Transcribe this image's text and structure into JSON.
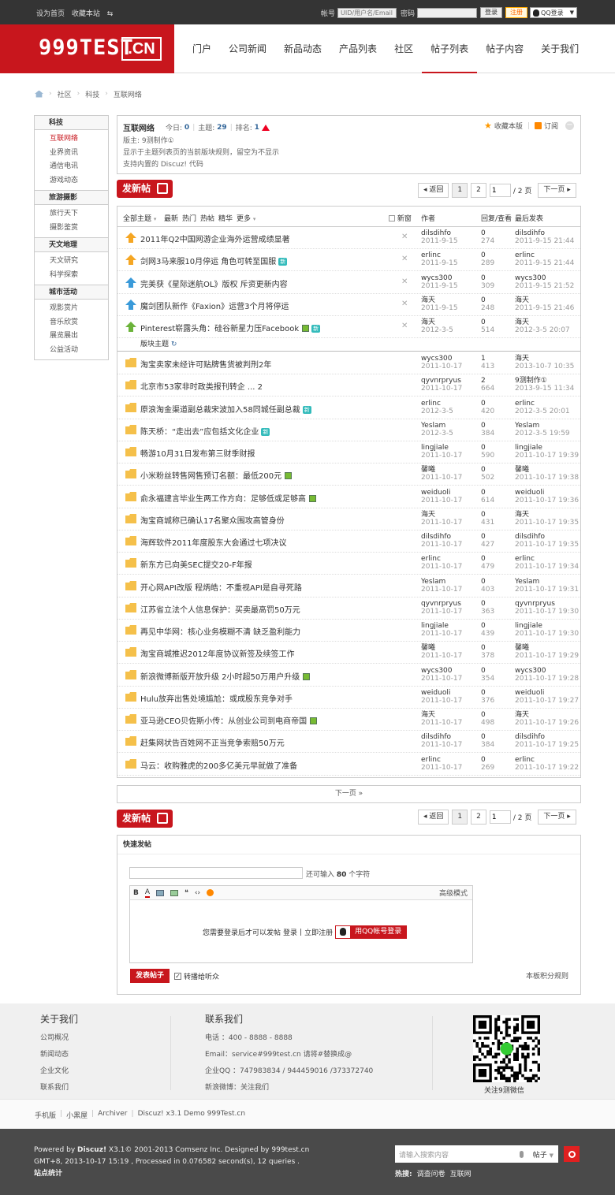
{
  "topbar": {
    "set_home": "设为首页",
    "bookmark": "收藏本站",
    "account_label": "帐号",
    "account_placeholder": "UID/用户名/Email",
    "password_label": "密码",
    "login": "登录",
    "register": "注册",
    "qq_login": "QQ登录"
  },
  "logo": {
    "text": "999TEST",
    "suffix": ".CN"
  },
  "nav": [
    "门户",
    "公司新闻",
    "新品动态",
    "产品列表",
    "社区",
    "帖子列表",
    "帖子内容",
    "关于我们"
  ],
  "nav_active": 5,
  "breadcrumb": [
    "社区",
    "科技",
    "互联网络"
  ],
  "sidebar": [
    {
      "title": "科技",
      "items": [
        "互联网络",
        "业界资讯",
        "通信电讯",
        "游戏动态"
      ]
    },
    {
      "title": "旅游摄影",
      "items": [
        "旅行天下",
        "摄影鉴赏"
      ]
    },
    {
      "title": "天文地理",
      "items": [
        "天文研究",
        "科学探索"
      ]
    },
    {
      "title": "城市活动",
      "items": [
        "观影赏片",
        "音乐欣赏",
        "展览展出",
        "公益活动"
      ]
    }
  ],
  "forum": {
    "name": "互联网络",
    "today_label": "今日:",
    "today": "0",
    "topics_label": "主题:",
    "topics": "29",
    "rank_label": "排名:",
    "rank": "1",
    "fav": "收藏本版",
    "subscribe": "订阅",
    "moderator": "版主: 9测制作①",
    "desc1": "显示于主题列表页的当前版块规则，留空为不显示",
    "desc2": "支持内置的 Discuz! 代码"
  },
  "post_button": "发新帖",
  "pager": {
    "back": "返回",
    "p1": "1",
    "p2": "2",
    "input": "1",
    "total": "/ 2 页",
    "next": "下一页"
  },
  "filters": {
    "all": "全部主题",
    "latest": "最新",
    "hot": "热门",
    "hottopic": "热帖",
    "digest": "精华",
    "more": "更多",
    "newwin": "新窗",
    "author": "作者",
    "replies": "回复/查看",
    "lastpost": "最后发表"
  },
  "section_label": "版块主题",
  "sticky": [
    {
      "title": "2011年Q2中国网游企业海外运营成绩显著",
      "author": "dilsdihfo",
      "date": "2011-9-15",
      "r": "0",
      "v": "274",
      "la": "dilsdihfo",
      "ld": "2011-9-15 21:44",
      "ic": "up-orange",
      "tag": ""
    },
    {
      "title": "剑网3马来服10月停运 角色可转至国服",
      "author": "erlinc",
      "date": "2011-9-15",
      "r": "0",
      "v": "289",
      "la": "erlinc",
      "ld": "2011-9-15 21:44",
      "ic": "up-orange",
      "tag": "新"
    },
    {
      "title": "完美获《星际迷航OL》版权 斥资更新内容",
      "author": "wycs300",
      "date": "2011-9-15",
      "r": "0",
      "v": "309",
      "la": "wycs300",
      "ld": "2011-9-15 21:52",
      "ic": "up-blue",
      "tag": ""
    },
    {
      "title": "魔剑团队新作《Faxion》运营3个月将停运",
      "author": "海天",
      "date": "2011-9-15",
      "r": "0",
      "v": "248",
      "la": "海天",
      "ld": "2011-9-15 21:46",
      "ic": "up-blue",
      "tag": ""
    },
    {
      "title": "Pinterest崭露头角：硅谷新星力压Facebook",
      "author": "海天",
      "date": "2012-3-5",
      "r": "0",
      "v": "514",
      "la": "海天",
      "ld": "2012-3-5 20:07",
      "ic": "up-green",
      "tag": "img新"
    }
  ],
  "threads": [
    {
      "title": "淘宝卖家未经许可贴牌售货被判刑2年",
      "author": "wycs300",
      "date": "2011-10-17",
      "r": "1",
      "v": "413",
      "la": "海天",
      "ld": "2013-10-7 10:35",
      "tag": ""
    },
    {
      "title": "北京市53家非时政类报刊转企  ... 2",
      "author": "qyvnrpryus",
      "date": "2011-10-17",
      "r": "2",
      "v": "664",
      "la": "9测制作①",
      "ld": "2013-9-15 11:34",
      "tag": ""
    },
    {
      "title": "原浪淘金渠道副总裁宋波加入58同城任副总裁",
      "author": "erlinc",
      "date": "2012-3-5",
      "r": "0",
      "v": "420",
      "la": "erlinc",
      "ld": "2012-3-5 20:01",
      "tag": "新"
    },
    {
      "title": "陈天桥：“走出去”应包括文化企业",
      "author": "Yeslam",
      "date": "2012-3-5",
      "r": "0",
      "v": "384",
      "la": "Yeslam",
      "ld": "2012-3-5 19:59",
      "tag": "新"
    },
    {
      "title": "畅游10月31日发布第三财季财报",
      "author": "lingjiale",
      "date": "2011-10-17",
      "r": "0",
      "v": "590",
      "la": "lingjiale",
      "ld": "2011-10-17 19:39",
      "tag": ""
    },
    {
      "title": "小米粉丝转售网售预订名额：最低200元",
      "author": "馨曦",
      "date": "2011-10-17",
      "r": "0",
      "v": "502",
      "la": "馨曦",
      "ld": "2011-10-17 19:38",
      "tag": "img"
    },
    {
      "title": "俞永福建言毕业生两工作方向：足够低或足够高",
      "author": "weiduoli",
      "date": "2011-10-17",
      "r": "0",
      "v": "614",
      "la": "weiduoli",
      "ld": "2011-10-17 19:36",
      "tag": "img"
    },
    {
      "title": "淘宝商城称已确认17名聚众围攻高管身份",
      "author": "海天",
      "date": "2011-10-17",
      "r": "0",
      "v": "431",
      "la": "海天",
      "ld": "2011-10-17 19:35",
      "tag": ""
    },
    {
      "title": "海辉软件2011年度股东大会通过七项决议",
      "author": "dilsdihfo",
      "date": "2011-10-17",
      "r": "0",
      "v": "427",
      "la": "dilsdihfo",
      "ld": "2011-10-17 19:35",
      "tag": ""
    },
    {
      "title": "新东方已向美SEC提交20-F年报",
      "author": "erlinc",
      "date": "2011-10-17",
      "r": "0",
      "v": "479",
      "la": "erlinc",
      "ld": "2011-10-17 19:34",
      "tag": ""
    },
    {
      "title": "开心网API改版 程炳皓：不重视API是自寻死路",
      "author": "Yeslam",
      "date": "2011-10-17",
      "r": "0",
      "v": "403",
      "la": "Yeslam",
      "ld": "2011-10-17 19:31",
      "tag": ""
    },
    {
      "title": "江苏省立法个人信息保护：买卖最高罚50万元",
      "author": "qyvnrpryus",
      "date": "2011-10-17",
      "r": "0",
      "v": "363",
      "la": "qyvnrpryus",
      "ld": "2011-10-17 19:30",
      "tag": ""
    },
    {
      "title": "再见中华网：核心业务模糊不清 缺乏盈利能力",
      "author": "lingjiale",
      "date": "2011-10-17",
      "r": "0",
      "v": "439",
      "la": "lingjiale",
      "ld": "2011-10-17 19:30",
      "tag": ""
    },
    {
      "title": "淘宝商城推迟2012年度协议新签及续签工作",
      "author": "馨曦",
      "date": "2011-10-17",
      "r": "0",
      "v": "378",
      "la": "馨曦",
      "ld": "2011-10-17 19:29",
      "tag": ""
    },
    {
      "title": "新浪微博新版开放升级 2小时超50万用户升级",
      "author": "wycs300",
      "date": "2011-10-17",
      "r": "0",
      "v": "354",
      "la": "wycs300",
      "ld": "2011-10-17 19:28",
      "tag": "img"
    },
    {
      "title": "Hulu放弃出售处境尴尬：或成股东竞争对手",
      "author": "weiduoli",
      "date": "2011-10-17",
      "r": "0",
      "v": "376",
      "la": "weiduoli",
      "ld": "2011-10-17 19:27",
      "tag": ""
    },
    {
      "title": "亚马逊CEO贝佐斯小传：从创业公司到电商帝国",
      "author": "海天",
      "date": "2011-10-17",
      "r": "0",
      "v": "498",
      "la": "海天",
      "ld": "2011-10-17 19:26",
      "tag": "img"
    },
    {
      "title": "赶集网状告百姓网不正当竞争索赔50万元",
      "author": "dilsdihfo",
      "date": "2011-10-17",
      "r": "0",
      "v": "384",
      "la": "dilsdihfo",
      "ld": "2011-10-17 19:25",
      "tag": ""
    },
    {
      "title": "马云：收购雅虎的200多亿美元早就做了准备",
      "author": "erlinc",
      "date": "2011-10-17",
      "r": "0",
      "v": "269",
      "la": "erlinc",
      "ld": "2011-10-17 19:22",
      "tag": ""
    }
  ],
  "next_page_bar": "下一页 »",
  "quick": {
    "title": "快速发帖",
    "remain_prefix": "还可输入",
    "remain": "80",
    "remain_suffix": "个字符",
    "adv": "高级模式",
    "need_login": "您需要登录后才可以发帖",
    "login": "登录",
    "sep": "|",
    "register": "立即注册",
    "qq_login": "用QQ帐号登录",
    "submit": "发表帖子",
    "broadcast": "转播给听众",
    "rules": "本板积分规则"
  },
  "footer": {
    "about_title": "关于我们",
    "about_links": [
      "公司概况",
      "新闻动态",
      "企业文化",
      "联系我们"
    ],
    "contact_title": "联系我们",
    "contact": [
      "电话 ：400 - 8888 - 8888",
      "Email：service#999test.cn 请将#替换成@",
      "企业QQ ：747983834 / 944459016 /373372740",
      "新浪微博：关注我们"
    ],
    "qr_caption": "关注9测微信",
    "links": [
      "手机版",
      "小黑屋",
      "Archiver",
      "Discuz! x3.1 Demo 999Test.cn"
    ],
    "powered_prefix": "Powered by",
    "powered_brand": "Discuz!",
    "powered_rest": "X3.1© 2001-2013 Comsenz Inc. Designed by 999test.cn",
    "gmt": "GMT+8, 2013-10-17 15:19 , Processed in 0.076582 second(s), 12 queries .",
    "stats": "站点统计",
    "search_placeholder": "请输入搜索内容",
    "search_type": "帖子",
    "hot_label": "热搜:",
    "hot": [
      "调查问卷",
      "互联网"
    ]
  }
}
